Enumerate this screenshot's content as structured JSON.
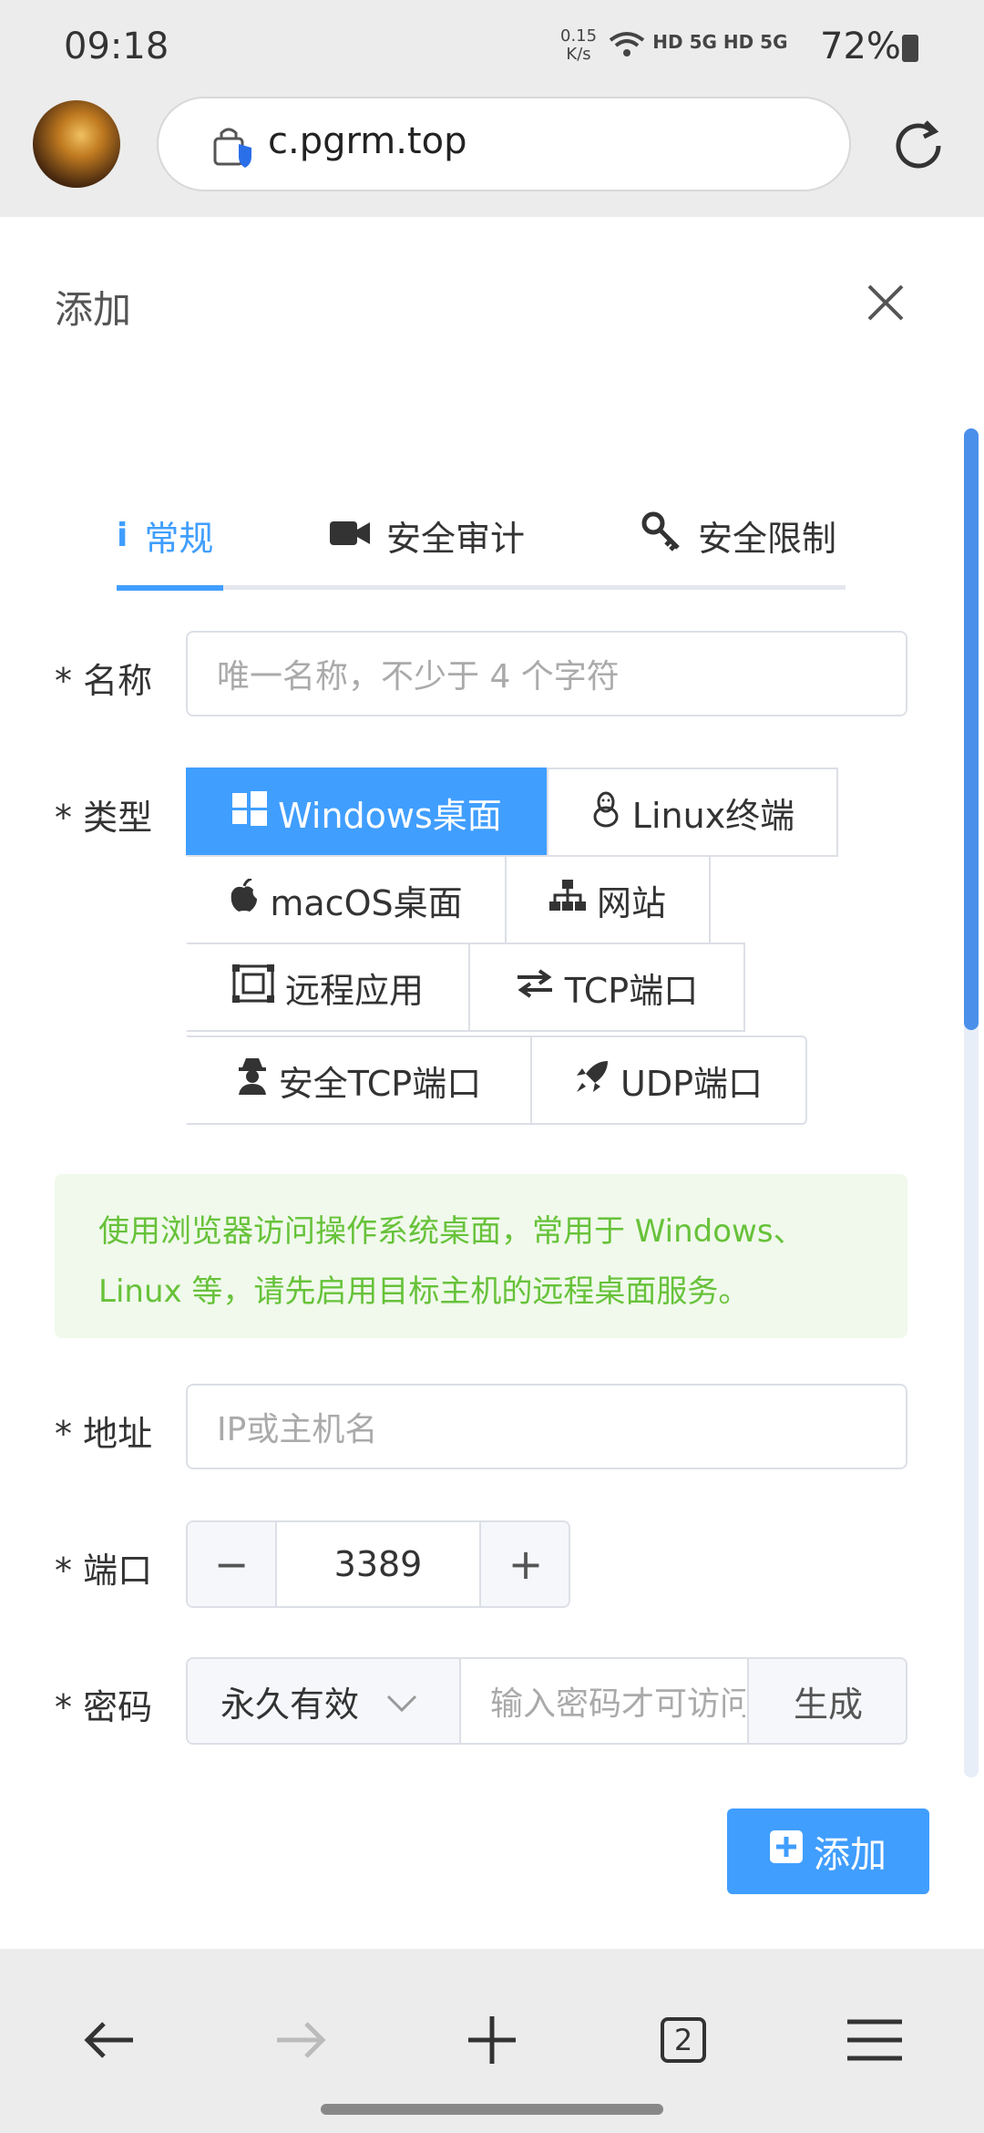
{
  "status_bar": {
    "time": "09:18",
    "net_speed_value": "0.15",
    "net_speed_unit": "K/s",
    "signal_text": "HD 5G HD 5G",
    "battery": "72%"
  },
  "browser": {
    "url": "c.pgrm.top",
    "tab_count": "2"
  },
  "dialog": {
    "title": "添加",
    "tabs": [
      {
        "label": "常规",
        "icon": "info-icon"
      },
      {
        "label": "安全审计",
        "icon": "video-camera-icon"
      },
      {
        "label": "安全限制",
        "icon": "key-icon"
      }
    ],
    "form": {
      "name": {
        "label": "* 名称",
        "placeholder": "唯一名称，不少于 4 个字符"
      },
      "type": {
        "label": "* 类型",
        "options": [
          {
            "label": "Windows桌面",
            "icon": "windows-icon",
            "selected": true
          },
          {
            "label": "Linux终端",
            "icon": "linux-penguin-icon",
            "selected": false
          },
          {
            "label": "macOS桌面",
            "icon": "apple-icon",
            "selected": false
          },
          {
            "label": "网站",
            "icon": "sitemap-icon",
            "selected": false
          },
          {
            "label": "远程应用",
            "icon": "remote-app-icon",
            "selected": false
          },
          {
            "label": "TCP端口",
            "icon": "exchange-icon",
            "selected": false
          },
          {
            "label": "安全TCP端口",
            "icon": "user-secret-icon",
            "selected": false
          },
          {
            "label": "UDP端口",
            "icon": "rocket-icon",
            "selected": false
          }
        ]
      },
      "hint": "使用浏览器访问操作系统桌面，常用于 Windows、Linux 等，请先启用目标主机的远程桌面服务。",
      "address": {
        "label": "* 地址",
        "placeholder": "IP或主机名"
      },
      "port": {
        "label": "* 端口",
        "value": "3389",
        "minus": "−",
        "plus": "+"
      },
      "password": {
        "label": "* 密码",
        "validity": "永久有效",
        "placeholder": "输入密码才可访问",
        "generate": "生成"
      },
      "submit": "添加"
    }
  },
  "colors": {
    "accent": "#409eff",
    "hint_bg": "#f0f9eb",
    "hint_text": "#67c23a"
  }
}
